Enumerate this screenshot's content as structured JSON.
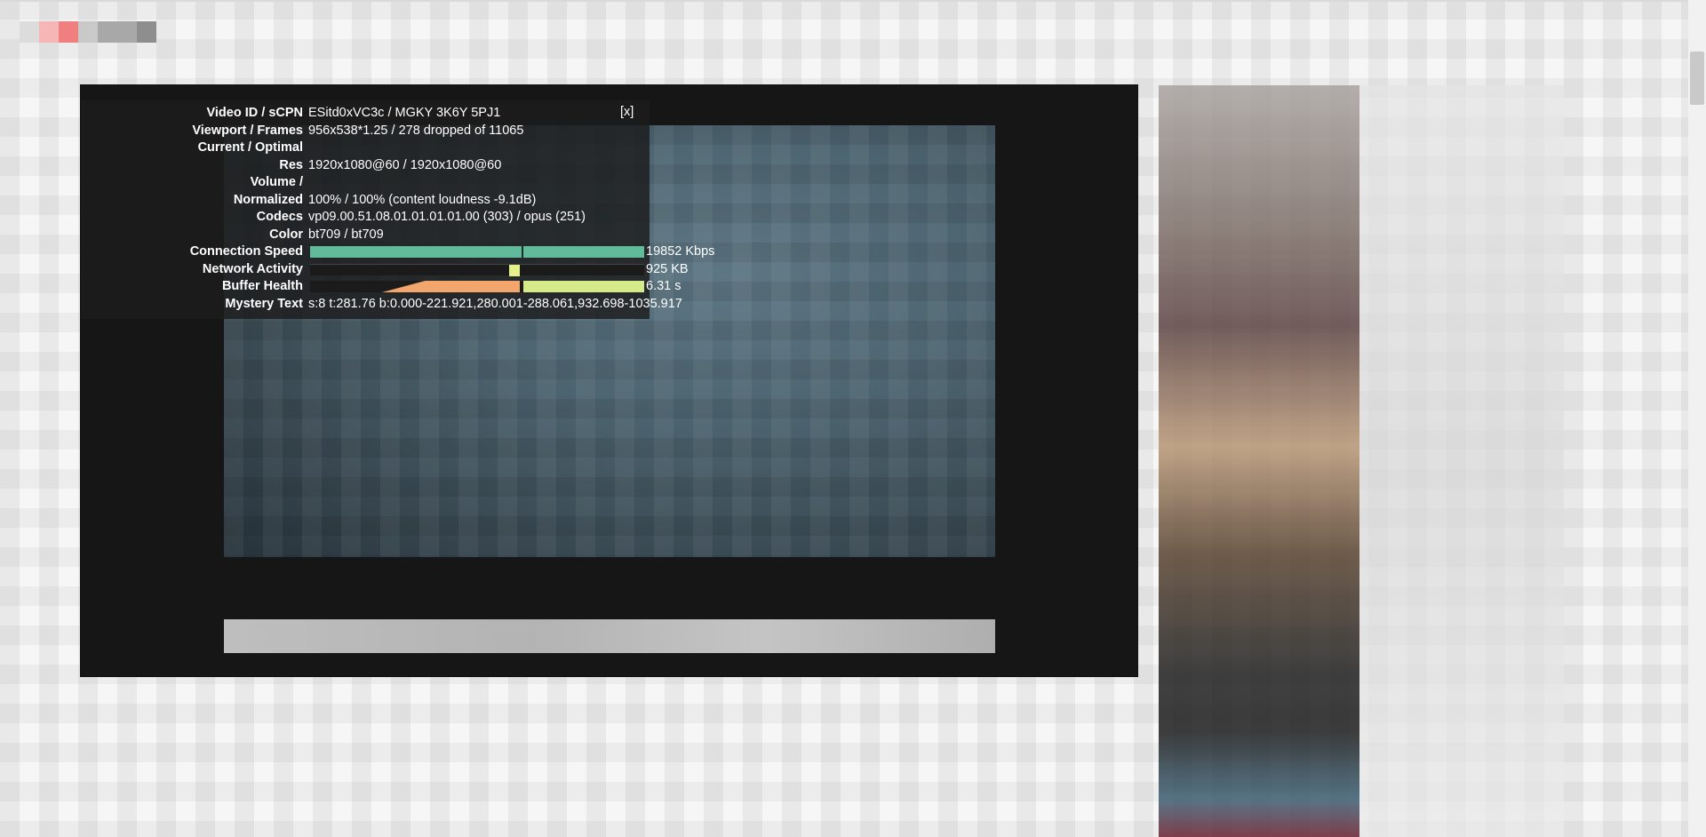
{
  "stats_panel": {
    "close_label": "[x]",
    "rows": [
      {
        "label": "Video ID / sCPN",
        "value": "ESitd0xVC3c / MGKY 3K6Y 5PJ1"
      },
      {
        "label": "Viewport / Frames",
        "value": "956x538*1.25 / 278 dropped of 11065"
      },
      {
        "label": "Current / Optimal",
        "value": ""
      },
      {
        "label": "Res",
        "value": "1920x1080@60 / 1920x1080@60"
      },
      {
        "label": "Volume /",
        "value": ""
      },
      {
        "label": "Normalized",
        "value": "100% / 100% (content loudness -9.1dB)"
      },
      {
        "label": "Codecs",
        "value": "vp09.00.51.08.01.01.01.01.00 (303) / opus (251)"
      },
      {
        "label": "Color",
        "value": "bt709 / bt709"
      },
      {
        "label": "Connection Speed",
        "value": "19852 Kbps"
      },
      {
        "label": "Network Activity",
        "value": "925 KB"
      },
      {
        "label": "Buffer Health",
        "value": "6.31 s"
      },
      {
        "label": "Mystery Text",
        "value": "s:8 t:281.76 b:0.000-221.921,280.001-288.061,932.698-1035.917"
      }
    ]
  },
  "colors": {
    "connection_bar": "#5fbb9a",
    "network_bar": "#e6f08b",
    "buffer_left": "#f2a66c",
    "buffer_right": "#d7ea89",
    "panel_bg": "#1c1c1c"
  }
}
